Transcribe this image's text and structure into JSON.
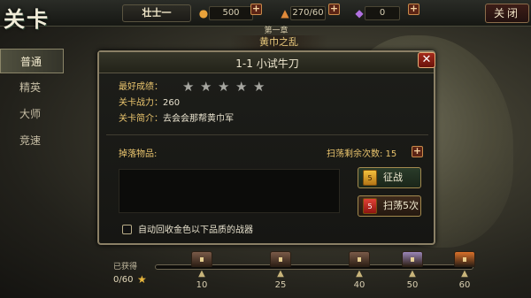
{
  "topbar": {
    "game_title": "关卡",
    "player_name": "壮士一",
    "gold": "500",
    "stamina": "270/60",
    "gems": "0",
    "close_label": "关闭"
  },
  "tabs": [
    {
      "label": "普通",
      "active": true
    },
    {
      "label": "精英",
      "active": false
    },
    {
      "label": "大师",
      "active": false
    },
    {
      "label": "竞速",
      "active": false
    }
  ],
  "chapter": {
    "subtitle": "第一章",
    "title": "黄巾之乱"
  },
  "dialog": {
    "title": "1-1 小试牛刀",
    "best_label": "最好成绩：",
    "best_stars": 0,
    "max_stars": 5,
    "power_label": "关卡战力：",
    "power_value": "260",
    "intro_label": "关卡简介：",
    "intro_value": "去会会那帮黄巾军",
    "drop_label": "掉落物品:",
    "sweep_remaining_label": "扫荡剩余次数: 15",
    "battle_label": "征战",
    "battle_icon_text": "5",
    "sweep5_label": "扫荡5次",
    "sweep5_icon_text": "5",
    "auto_recycle_label": "自动回收金色以下品质的战器",
    "auto_recycle_checked": false
  },
  "progress": {
    "obtained_label": "已获得",
    "obtained_count": "0/60",
    "current": 0,
    "max": 60,
    "milestones": [
      {
        "value": "10",
        "chest_color": "#7a5a48"
      },
      {
        "value": "25",
        "chest_color": "#7a5a48"
      },
      {
        "value": "40",
        "chest_color": "#7a5a48"
      },
      {
        "value": "50",
        "chest_color": "#9a86b8"
      },
      {
        "value": "60",
        "chest_color": "#d9712a"
      }
    ]
  },
  "colors": {
    "accent_gold": "#e9c46d",
    "chapter_title": "#e9c97c"
  }
}
